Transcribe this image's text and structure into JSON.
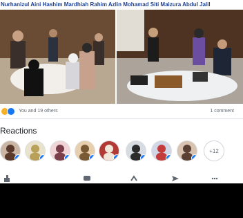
{
  "post": {
    "tagged_names": "Nurhanizul Aini Hashim Mardhiah Rahim Azlin Mohamad Siti Maizura Abdul Jalil",
    "reaction_summary": "You and 19 others",
    "comments_count": "1 comment"
  },
  "reactions": {
    "title": "Reactions",
    "avatars": [
      {
        "name": "avatar-1",
        "bg": "#c9b6a4",
        "fg": "#5a3a2a"
      },
      {
        "name": "avatar-2",
        "bg": "#e9e3ce",
        "fg": "#b9a15a"
      },
      {
        "name": "avatar-3",
        "bg": "#f0d4d8",
        "fg": "#7a3f4a"
      },
      {
        "name": "avatar-4",
        "bg": "#e7cfae",
        "fg": "#7a5a34"
      },
      {
        "name": "avatar-5",
        "bg": "#b23a35",
        "fg": "#f1e7d9"
      },
      {
        "name": "avatar-6",
        "bg": "#d7dbe2",
        "fg": "#2b2b2b"
      },
      {
        "name": "avatar-7",
        "bg": "#d2d7e8",
        "fg": "#c33b3b"
      },
      {
        "name": "avatar-8",
        "bg": "#d7c3af",
        "fg": "#5a4033"
      }
    ],
    "more_count": "+12"
  },
  "colors": {
    "link_blue": "#1c3f91",
    "fb_blue": "#1877f2",
    "muted": "#606770"
  }
}
